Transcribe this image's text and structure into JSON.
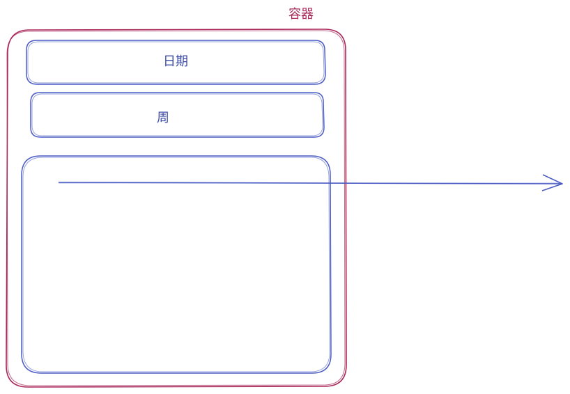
{
  "container": {
    "label": "容器"
  },
  "boxes": {
    "date_label": "日期",
    "week_label": "周"
  },
  "colors": {
    "container_stroke": "#a8285a",
    "box_stroke": "#4a5bc4",
    "label_text": "#3b4aa8",
    "container_label_text": "#a8285a"
  }
}
